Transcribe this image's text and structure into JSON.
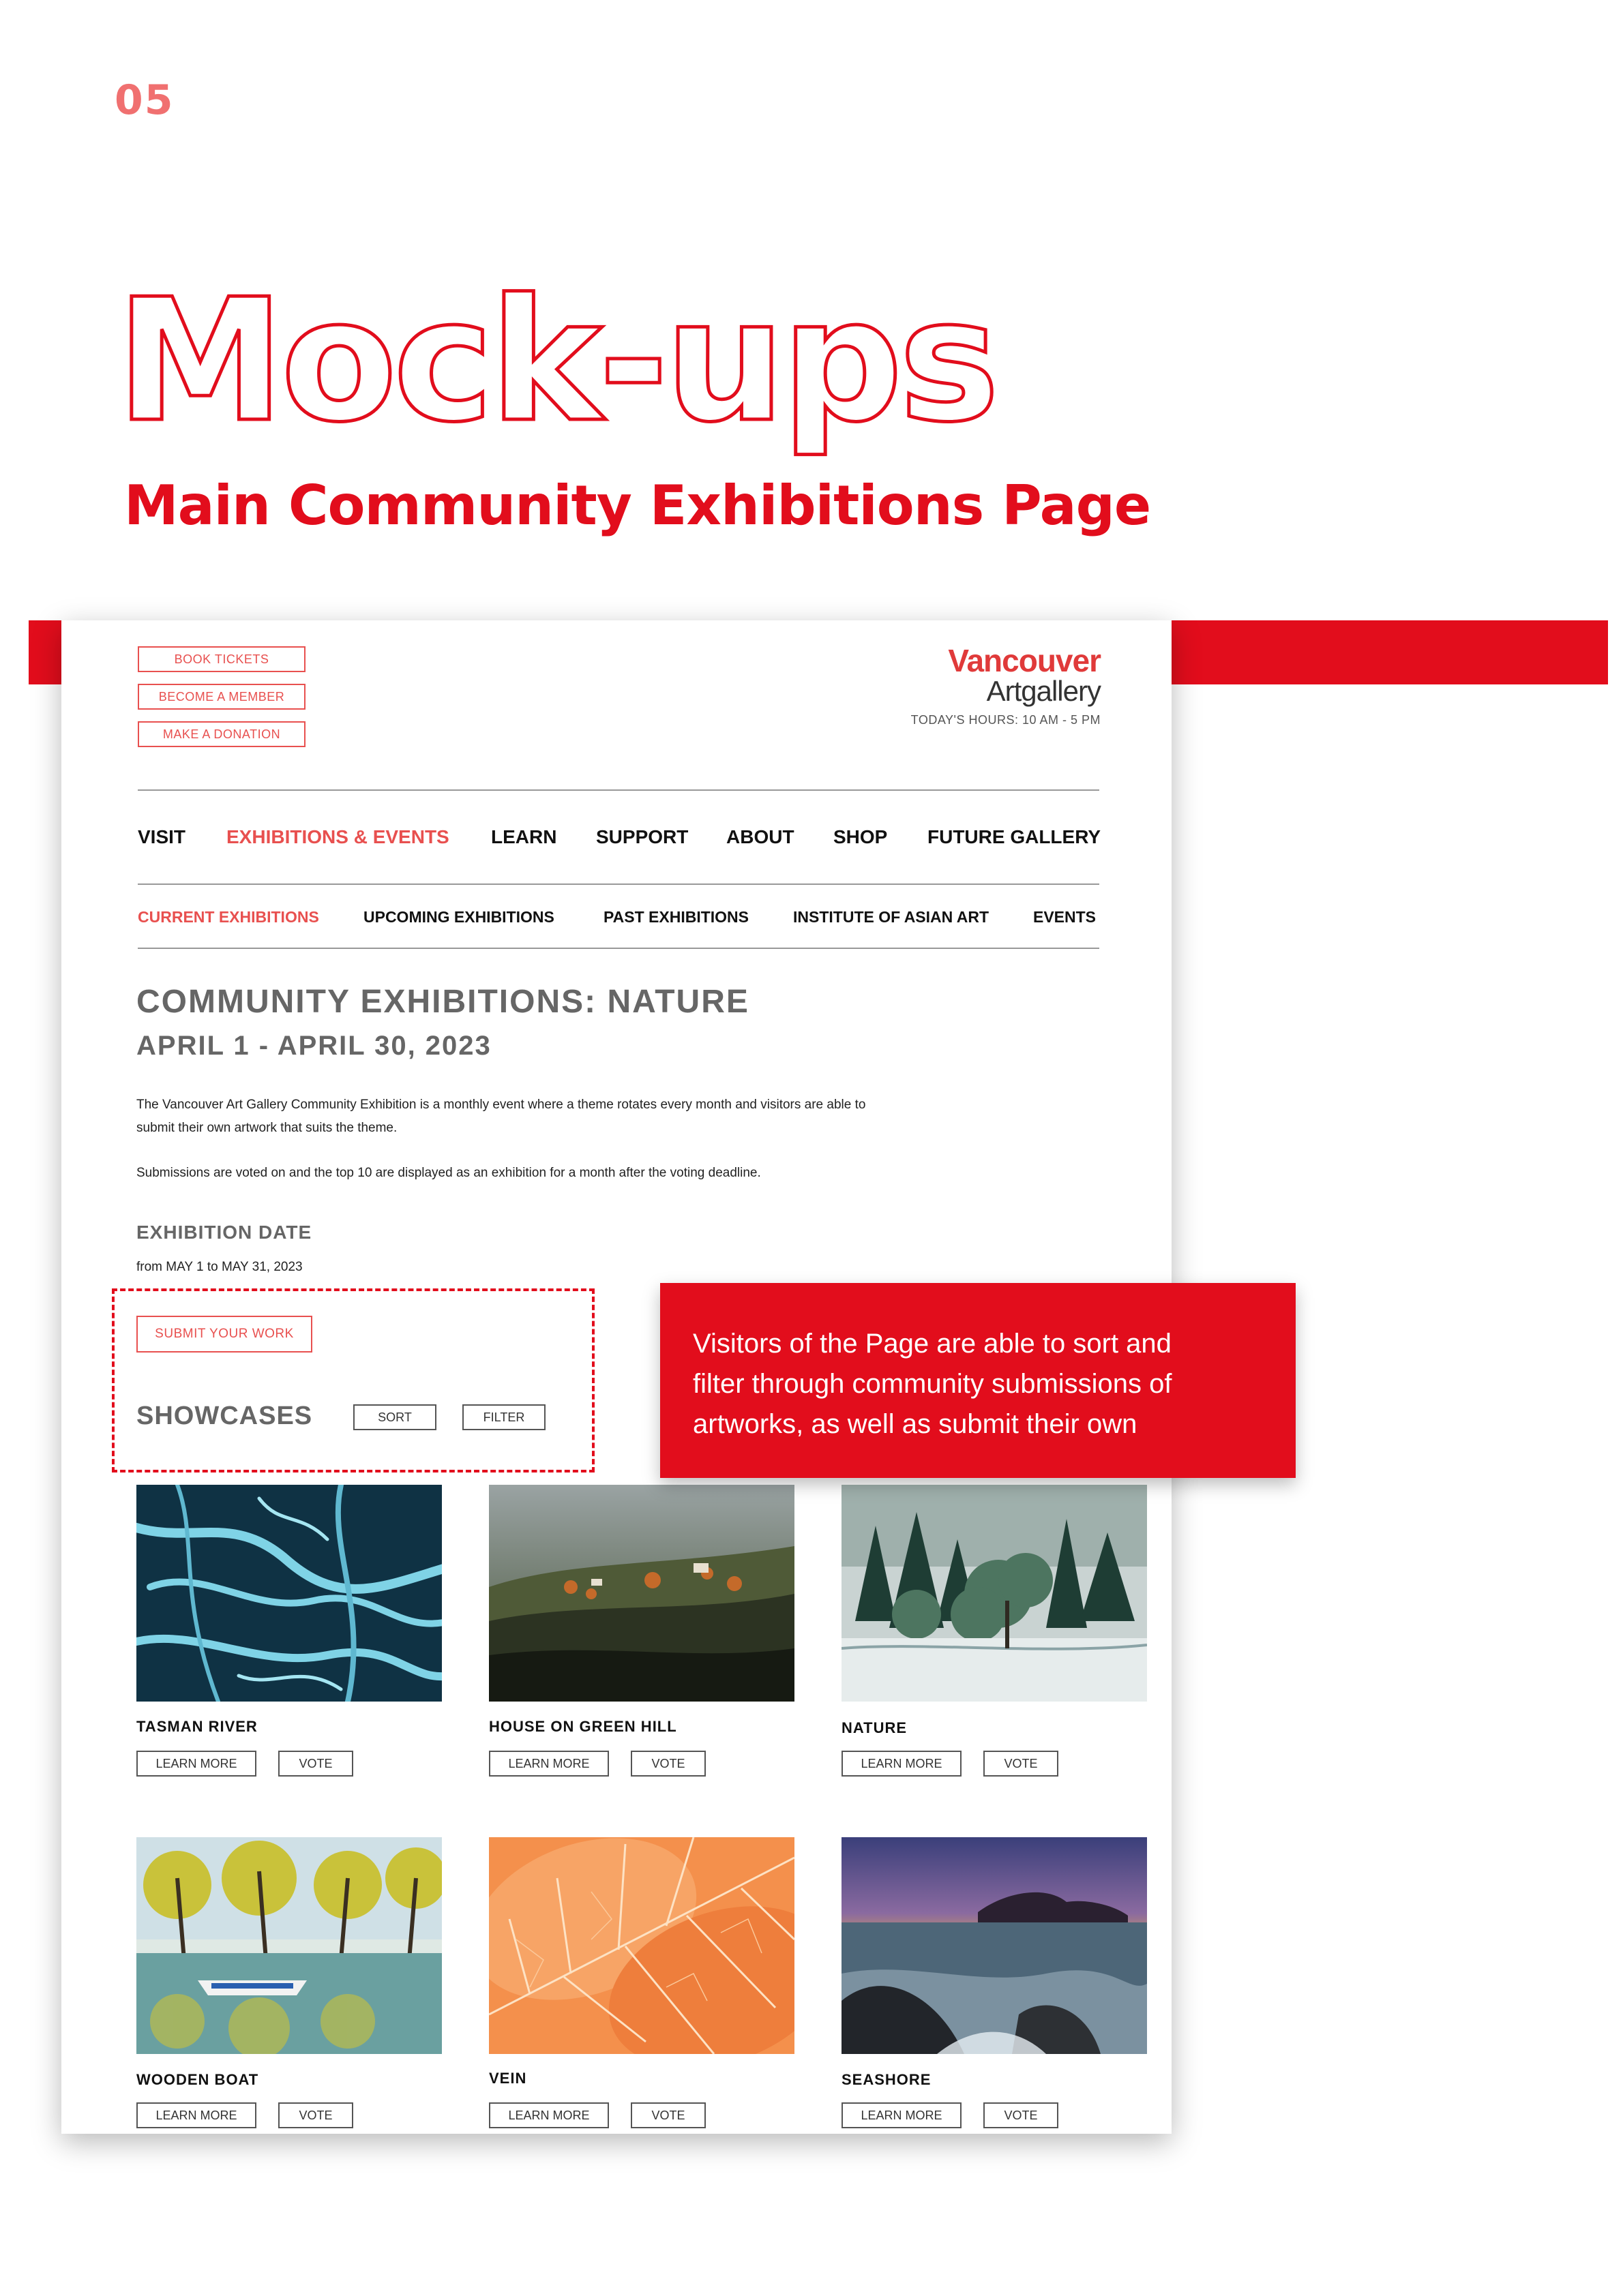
{
  "page_number": "05",
  "title": "Mock-ups",
  "subtitle": "Main Community Exhibitions Page",
  "mockup": {
    "header_buttons": [
      "BOOK TICKETS",
      "BECOME A MEMBER",
      "MAKE A DONATION"
    ],
    "logo": {
      "line1": "Vancouver",
      "line2": "Artgallery"
    },
    "hours": "TODAY'S HOURS: 10 AM - 5 PM",
    "nav": [
      "VISIT",
      "EXHIBITIONS & EVENTS",
      "LEARN",
      "SUPPORT",
      "ABOUT",
      "SHOP",
      "FUTURE GALLERY"
    ],
    "nav_active": "EXHIBITIONS & EVENTS",
    "subnav": [
      "CURRENT EXHIBITIONS",
      "UPCOMING EXHIBITIONS",
      "PAST EXHIBITIONS",
      "INSTITUTE OF ASIAN ART",
      "EVENTS"
    ],
    "subnav_active": "CURRENT EXHIBITIONS",
    "heading": "COMMUNITY  EXHIBITIONS:  NATURE",
    "dates": "APRIL  1  -  APRIL  30,  2023",
    "description_1a": "The Vancouver Art Gallery Community Exhibition is a monthly event where a theme rotates every month and visitors are able to",
    "description_1b": "submit their own artwork that suits the theme.",
    "description_2": "Submissions are voted on and the top 10 are displayed as an exhibition for a month after the voting deadline.",
    "exhibition_date_label": "EXHIBITION  DATE",
    "exhibition_date_value": "from MAY 1 to MAY 31, 2023",
    "submit_button": "SUBMIT YOUR WORK",
    "showcases_label": "SHOWCASES",
    "sort_button": "SORT",
    "filter_button": "FILTER",
    "learn_more_label": "LEARN MORE",
    "vote_label": "VOTE",
    "artworks": [
      {
        "title": "TASMAN  RIVER"
      },
      {
        "title": "HOUSE  ON  GREEN  HILL"
      },
      {
        "title": "NATURE"
      },
      {
        "title": "WOODEN  BOAT"
      },
      {
        "title": "VEIN"
      },
      {
        "title": "SEASHORE"
      }
    ]
  },
  "callout": {
    "line1": "Visitors of the Page are able to sort and",
    "line2": "filter through community  submissions of",
    "line3": "artworks, as well as submit their own"
  },
  "colors": {
    "accent": "#e20d1c",
    "mock_accent": "#e8504f",
    "page_number": "#f07070"
  }
}
